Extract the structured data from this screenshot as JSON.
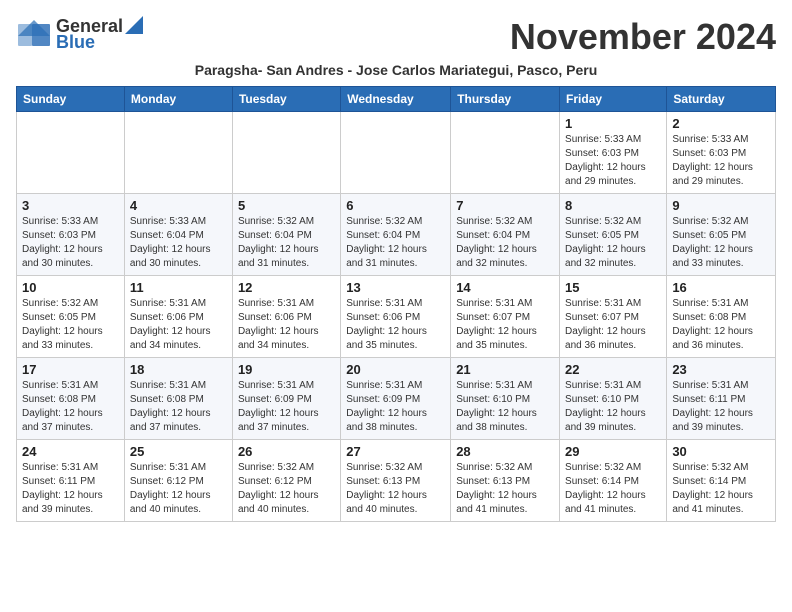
{
  "header": {
    "logo_general": "General",
    "logo_blue": "Blue",
    "month_title": "November 2024",
    "subtitle": "Paragsha- San Andres - Jose Carlos Mariategui, Pasco, Peru"
  },
  "weekdays": [
    "Sunday",
    "Monday",
    "Tuesday",
    "Wednesday",
    "Thursday",
    "Friday",
    "Saturday"
  ],
  "weeks": [
    [
      {
        "day": "",
        "info": ""
      },
      {
        "day": "",
        "info": ""
      },
      {
        "day": "",
        "info": ""
      },
      {
        "day": "",
        "info": ""
      },
      {
        "day": "",
        "info": ""
      },
      {
        "day": "1",
        "info": "Sunrise: 5:33 AM\nSunset: 6:03 PM\nDaylight: 12 hours and 29 minutes."
      },
      {
        "day": "2",
        "info": "Sunrise: 5:33 AM\nSunset: 6:03 PM\nDaylight: 12 hours and 29 minutes."
      }
    ],
    [
      {
        "day": "3",
        "info": "Sunrise: 5:33 AM\nSunset: 6:03 PM\nDaylight: 12 hours and 30 minutes."
      },
      {
        "day": "4",
        "info": "Sunrise: 5:33 AM\nSunset: 6:04 PM\nDaylight: 12 hours and 30 minutes."
      },
      {
        "day": "5",
        "info": "Sunrise: 5:32 AM\nSunset: 6:04 PM\nDaylight: 12 hours and 31 minutes."
      },
      {
        "day": "6",
        "info": "Sunrise: 5:32 AM\nSunset: 6:04 PM\nDaylight: 12 hours and 31 minutes."
      },
      {
        "day": "7",
        "info": "Sunrise: 5:32 AM\nSunset: 6:04 PM\nDaylight: 12 hours and 32 minutes."
      },
      {
        "day": "8",
        "info": "Sunrise: 5:32 AM\nSunset: 6:05 PM\nDaylight: 12 hours and 32 minutes."
      },
      {
        "day": "9",
        "info": "Sunrise: 5:32 AM\nSunset: 6:05 PM\nDaylight: 12 hours and 33 minutes."
      }
    ],
    [
      {
        "day": "10",
        "info": "Sunrise: 5:32 AM\nSunset: 6:05 PM\nDaylight: 12 hours and 33 minutes."
      },
      {
        "day": "11",
        "info": "Sunrise: 5:31 AM\nSunset: 6:06 PM\nDaylight: 12 hours and 34 minutes."
      },
      {
        "day": "12",
        "info": "Sunrise: 5:31 AM\nSunset: 6:06 PM\nDaylight: 12 hours and 34 minutes."
      },
      {
        "day": "13",
        "info": "Sunrise: 5:31 AM\nSunset: 6:06 PM\nDaylight: 12 hours and 35 minutes."
      },
      {
        "day": "14",
        "info": "Sunrise: 5:31 AM\nSunset: 6:07 PM\nDaylight: 12 hours and 35 minutes."
      },
      {
        "day": "15",
        "info": "Sunrise: 5:31 AM\nSunset: 6:07 PM\nDaylight: 12 hours and 36 minutes."
      },
      {
        "day": "16",
        "info": "Sunrise: 5:31 AM\nSunset: 6:08 PM\nDaylight: 12 hours and 36 minutes."
      }
    ],
    [
      {
        "day": "17",
        "info": "Sunrise: 5:31 AM\nSunset: 6:08 PM\nDaylight: 12 hours and 37 minutes."
      },
      {
        "day": "18",
        "info": "Sunrise: 5:31 AM\nSunset: 6:08 PM\nDaylight: 12 hours and 37 minutes."
      },
      {
        "day": "19",
        "info": "Sunrise: 5:31 AM\nSunset: 6:09 PM\nDaylight: 12 hours and 37 minutes."
      },
      {
        "day": "20",
        "info": "Sunrise: 5:31 AM\nSunset: 6:09 PM\nDaylight: 12 hours and 38 minutes."
      },
      {
        "day": "21",
        "info": "Sunrise: 5:31 AM\nSunset: 6:10 PM\nDaylight: 12 hours and 38 minutes."
      },
      {
        "day": "22",
        "info": "Sunrise: 5:31 AM\nSunset: 6:10 PM\nDaylight: 12 hours and 39 minutes."
      },
      {
        "day": "23",
        "info": "Sunrise: 5:31 AM\nSunset: 6:11 PM\nDaylight: 12 hours and 39 minutes."
      }
    ],
    [
      {
        "day": "24",
        "info": "Sunrise: 5:31 AM\nSunset: 6:11 PM\nDaylight: 12 hours and 39 minutes."
      },
      {
        "day": "25",
        "info": "Sunrise: 5:31 AM\nSunset: 6:12 PM\nDaylight: 12 hours and 40 minutes."
      },
      {
        "day": "26",
        "info": "Sunrise: 5:32 AM\nSunset: 6:12 PM\nDaylight: 12 hours and 40 minutes."
      },
      {
        "day": "27",
        "info": "Sunrise: 5:32 AM\nSunset: 6:13 PM\nDaylight: 12 hours and 40 minutes."
      },
      {
        "day": "28",
        "info": "Sunrise: 5:32 AM\nSunset: 6:13 PM\nDaylight: 12 hours and 41 minutes."
      },
      {
        "day": "29",
        "info": "Sunrise: 5:32 AM\nSunset: 6:14 PM\nDaylight: 12 hours and 41 minutes."
      },
      {
        "day": "30",
        "info": "Sunrise: 5:32 AM\nSunset: 6:14 PM\nDaylight: 12 hours and 41 minutes."
      }
    ]
  ]
}
